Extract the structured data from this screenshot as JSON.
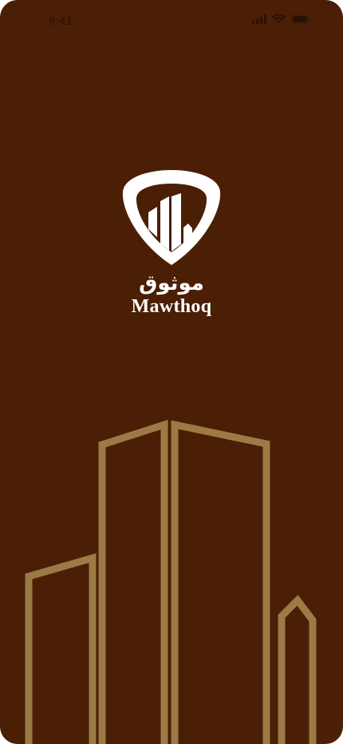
{
  "status_bar": {
    "time": "9:41",
    "icons": [
      "signal-icon",
      "wifi-icon",
      "battery-icon"
    ]
  },
  "brand": {
    "arabic_name": "موثوق",
    "latin_name": "Mawthoq",
    "logo_icon": "shield-buildings-icon"
  },
  "colors": {
    "background": "#4a1f05",
    "skyline_outline": "#9c7a45",
    "logo": "#ffffff",
    "status_text": "#2a1103"
  },
  "decoration": {
    "skyline_icon": "skyline-outline-illustration"
  }
}
